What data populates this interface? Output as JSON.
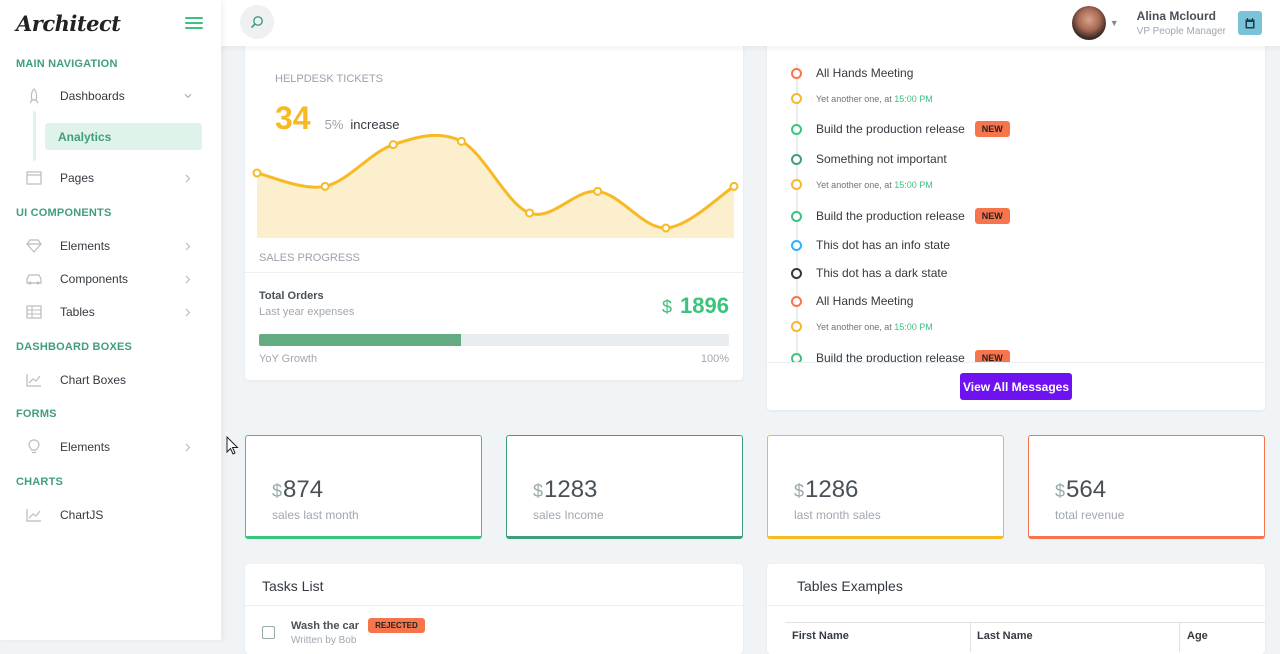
{
  "app": {
    "logo": "Architect"
  },
  "sidebar": {
    "headings": [
      "MAIN NAVIGATION",
      "UI COMPONENTS",
      "DASHBOARD BOXES",
      "FORMS",
      "CHARTS"
    ],
    "items": [
      {
        "label": "Dashboards",
        "icon": "rocket-icon"
      },
      {
        "label": "Analytics"
      },
      {
        "label": "Pages",
        "icon": "browser-icon"
      },
      {
        "label": "Elements",
        "icon": "diamond-icon"
      },
      {
        "label": "Components",
        "icon": "car-icon"
      },
      {
        "label": "Tables",
        "icon": "table-icon"
      },
      {
        "label": "Chart Boxes",
        "icon": "graph-icon"
      },
      {
        "label": "Elements",
        "icon": "lightbulb-icon"
      },
      {
        "label": "ChartJS",
        "icon": "graph-icon"
      }
    ]
  },
  "header": {
    "user_name": "Alina Mclourd",
    "user_role": "VP People Manager"
  },
  "helpdesk": {
    "title": "HELPDESK TICKETS",
    "value": "34",
    "pct": "5%",
    "trend": "increase",
    "chart_data": {
      "type": "area",
      "values": [
        7.9,
        7.1,
        9.6,
        9.8,
        5.5,
        6.8,
        4.6,
        7.1
      ]
    }
  },
  "sales": {
    "section": "SALES PROGRESS",
    "label": "Total Orders",
    "sublabel": "Last year expenses",
    "currency": "$",
    "amount": "1896",
    "progress": 0.43,
    "left": "YoY Growth",
    "right": "100%"
  },
  "timeline": {
    "items": [
      {
        "text": "All Hands Meeting",
        "color": "#f7754d",
        "kind": "title"
      },
      {
        "text": "Yet another one, at ",
        "time": "15:00 PM",
        "color": "#f7b924",
        "kind": "small"
      },
      {
        "text": "Build the production release",
        "badge": "NEW",
        "color": "#3ac47d",
        "kind": "title"
      },
      {
        "text": "Something not important",
        "color": "#3f9f7a",
        "kind": "title"
      },
      {
        "text": "Yet another one, at ",
        "time": "15:00 PM",
        "color": "#f7b924",
        "kind": "small"
      },
      {
        "text": "Build the production release",
        "badge": "NEW",
        "color": "#3ac47d",
        "kind": "title"
      },
      {
        "text": "This dot has an info state",
        "color": "#30b1ff",
        "kind": "title"
      },
      {
        "text": "This dot has a dark state",
        "color": "#343a40",
        "kind": "title"
      },
      {
        "text": "All Hands Meeting",
        "color": "#f7754d",
        "kind": "title"
      },
      {
        "text": "Yet another one, at ",
        "time": "15:00 PM",
        "color": "#f7b924",
        "kind": "small"
      },
      {
        "text": "Build the production release",
        "badge": "NEW",
        "color": "#3ac47d",
        "kind": "title"
      }
    ],
    "button": "View All Messages"
  },
  "stats": [
    {
      "currency": "$",
      "value": "874",
      "label": "sales last month",
      "color": "#3ac47d"
    },
    {
      "currency": "$",
      "value": "1283",
      "label": "sales Income",
      "color": "#3f9f7a"
    },
    {
      "currency": "$",
      "value": "1286",
      "label": "last month sales",
      "color": "#f7b924"
    },
    {
      "currency": "$",
      "value": "564",
      "label": "total revenue",
      "color": "#f7754d"
    }
  ],
  "tasks": {
    "title": "Tasks List",
    "item": {
      "title": "Wash the car",
      "badge": "REJECTED",
      "sub": "Written by Bob"
    }
  },
  "tables": {
    "title": "Tables Examples",
    "columns": [
      "First Name",
      "Last Name",
      "Age"
    ]
  },
  "colors": {
    "success": "#3ac47d",
    "warning": "#f7b924",
    "danger": "#f7754d",
    "primary": "#6f12f1",
    "info": "#78c3d8"
  }
}
